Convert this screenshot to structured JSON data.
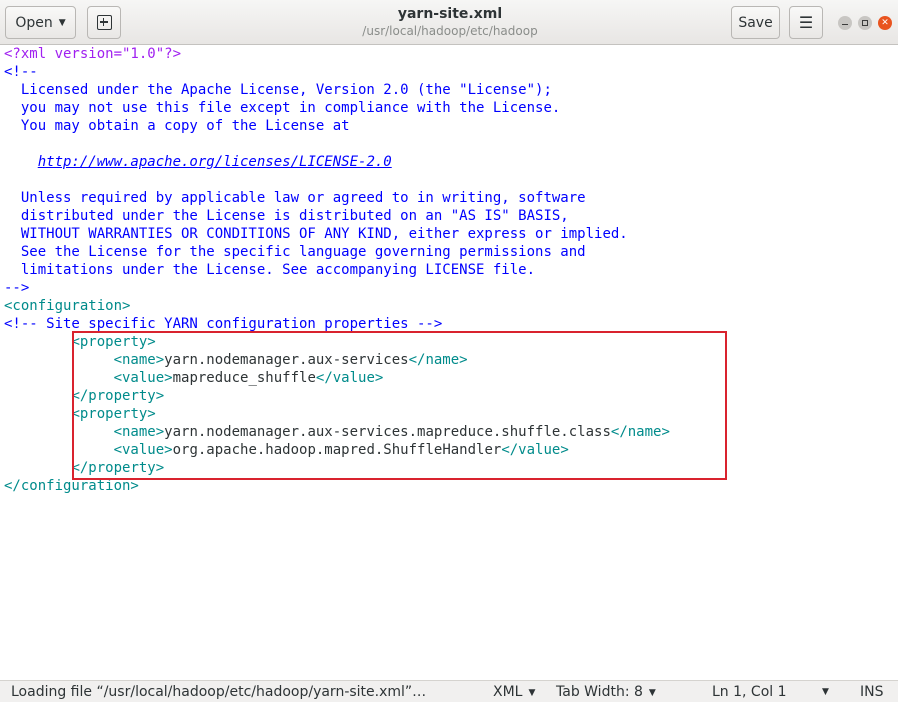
{
  "header": {
    "open_label": "Open",
    "title": "yarn-site.xml",
    "subtitle": "/usr/local/hadoop/etc/hadoop",
    "save_label": "Save",
    "menu_icon": "☰"
  },
  "editor": {
    "lines": [
      {
        "parts": [
          {
            "t": "<?xml version=\"1.0\"?>",
            "c": "pi"
          }
        ]
      },
      {
        "parts": [
          {
            "t": "<!--",
            "c": "comment"
          }
        ]
      },
      {
        "parts": [
          {
            "t": "  Licensed under the Apache License, Version 2.0 (the \"License\");",
            "c": "comment"
          }
        ]
      },
      {
        "parts": [
          {
            "t": "  you may not use this file except in compliance with the License.",
            "c": "comment"
          }
        ]
      },
      {
        "parts": [
          {
            "t": "  You may obtain a copy of the License at",
            "c": "comment"
          }
        ]
      },
      {
        "parts": [
          {
            "t": "",
            "c": "comment"
          }
        ]
      },
      {
        "parts": [
          {
            "t": "    ",
            "c": "comment"
          },
          {
            "t": "http://www.apache.org/licenses/LICENSE-2.0",
            "c": "link"
          }
        ]
      },
      {
        "parts": [
          {
            "t": "",
            "c": "comment"
          }
        ]
      },
      {
        "parts": [
          {
            "t": "  Unless required by applicable law or agreed to in writing, software",
            "c": "comment"
          }
        ]
      },
      {
        "parts": [
          {
            "t": "  distributed under the License is distributed on an \"AS IS\" BASIS,",
            "c": "comment"
          }
        ]
      },
      {
        "parts": [
          {
            "t": "  WITHOUT WARRANTIES OR CONDITIONS OF ANY KIND, either express or implied.",
            "c": "comment"
          }
        ]
      },
      {
        "parts": [
          {
            "t": "  See the License for the specific language governing permissions and",
            "c": "comment"
          }
        ]
      },
      {
        "parts": [
          {
            "t": "  limitations under the License. See accompanying LICENSE file.",
            "c": "comment"
          }
        ]
      },
      {
        "parts": [
          {
            "t": "-->",
            "c": "comment"
          }
        ]
      },
      {
        "parts": [
          {
            "t": "<configuration>",
            "c": "tag"
          }
        ]
      },
      {
        "parts": [
          {
            "t": "<!-- Site specific YARN configuration properties -->",
            "c": "comment"
          }
        ]
      },
      {
        "parts": [
          {
            "t": "        ",
            "c": "text"
          },
          {
            "t": "<property>",
            "c": "tag"
          }
        ]
      },
      {
        "parts": [
          {
            "t": "             ",
            "c": "text"
          },
          {
            "t": "<name>",
            "c": "tag"
          },
          {
            "t": "yarn.nodemanager.aux-services",
            "c": "text"
          },
          {
            "t": "</name>",
            "c": "tag"
          }
        ]
      },
      {
        "parts": [
          {
            "t": "             ",
            "c": "text"
          },
          {
            "t": "<value>",
            "c": "tag"
          },
          {
            "t": "mapreduce_shuffle",
            "c": "text"
          },
          {
            "t": "</value>",
            "c": "tag"
          }
        ]
      },
      {
        "parts": [
          {
            "t": "        ",
            "c": "text"
          },
          {
            "t": "</property>",
            "c": "tag"
          }
        ]
      },
      {
        "parts": [
          {
            "t": "        ",
            "c": "text"
          },
          {
            "t": "<property>",
            "c": "tag"
          }
        ]
      },
      {
        "parts": [
          {
            "t": "             ",
            "c": "text"
          },
          {
            "t": "<name>",
            "c": "tag"
          },
          {
            "t": "yarn.nodemanager.aux-services.mapreduce.shuffle.class",
            "c": "text"
          },
          {
            "t": "</name>",
            "c": "tag"
          }
        ]
      },
      {
        "parts": [
          {
            "t": "             ",
            "c": "text"
          },
          {
            "t": "<value>",
            "c": "tag"
          },
          {
            "t": "org.apache.hadoop.mapred.ShuffleHandler",
            "c": "text"
          },
          {
            "t": "</value>",
            "c": "tag"
          }
        ]
      },
      {
        "parts": [
          {
            "t": "        ",
            "c": "text"
          },
          {
            "t": "</property>",
            "c": "tag"
          }
        ]
      },
      {
        "parts": [
          {
            "t": "</configuration>",
            "c": "tag"
          }
        ]
      }
    ]
  },
  "statusbar": {
    "message": "Loading file “/usr/local/hadoop/etc/hadoop/yarn-site.xml”…",
    "language": "XML",
    "tab_width": "Tab Width: 8",
    "position": "Ln 1, Col 1",
    "mode": "INS"
  },
  "colors": {
    "highlight_box": "#d9232e",
    "comment": "#0000ff",
    "tag": "#008b8b",
    "pi": "#a020f0"
  }
}
